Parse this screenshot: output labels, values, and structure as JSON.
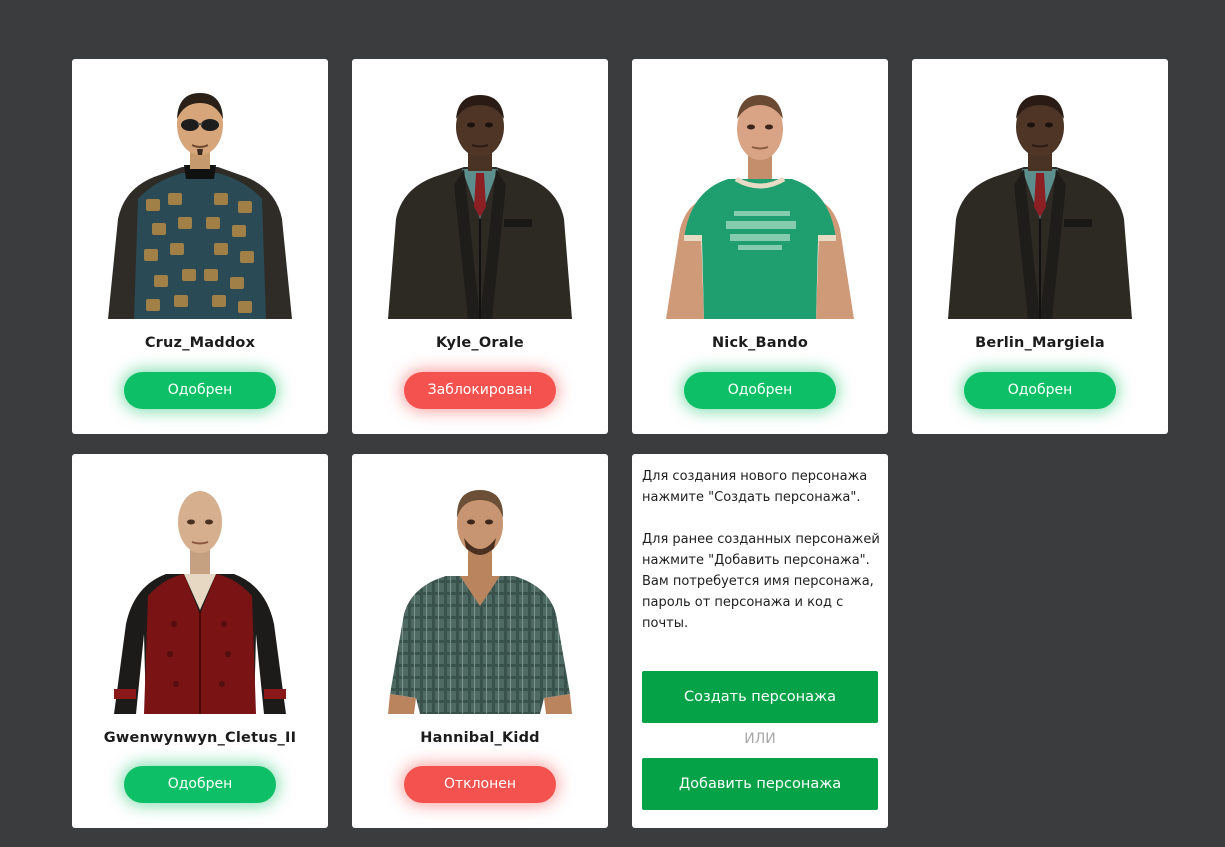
{
  "characters": [
    {
      "name": "Cruz_Maddox",
      "status": "Одобрен",
      "status_color": "#0dbf66",
      "icon": "character-avatar-icon"
    },
    {
      "name": "Kyle_Orale",
      "status": "Заблокирован",
      "status_color": "#f3524f",
      "icon": "character-avatar-icon"
    },
    {
      "name": "Nick_Bando",
      "status": "Одобрен",
      "status_color": "#0dbf66",
      "icon": "character-avatar-icon"
    },
    {
      "name": "Berlin_Margiela",
      "status": "Одобрен",
      "status_color": "#0dbf66",
      "icon": "character-avatar-icon"
    },
    {
      "name": "Gwenwynwyn_Cletus_II",
      "status": "Одобрен",
      "status_color": "#0dbf66",
      "icon": "character-avatar-icon"
    },
    {
      "name": "Hannibal_Kidd",
      "status": "Отклонен",
      "status_color": "#f3524f",
      "icon": "character-avatar-icon"
    }
  ],
  "info": {
    "line1": "Для создания нового персонажа",
    "line2": "нажмите \"Создать персонажа\".",
    "line3": "Для ранее созданных персонажей",
    "line4": "нажмите \"Добавить персонажа\".",
    "line5": "Вам потребуется имя персонажа,",
    "line6": "пароль от персонажа и код с",
    "line7": "почты.",
    "create_label": "Создать персонажа",
    "or_label": "ИЛИ",
    "add_label": "Добавить персонажа"
  },
  "colors": {
    "background": "#3b3c3e",
    "approved": "#0dbf66",
    "rejected": "#f3524f",
    "action": "#06a248"
  }
}
